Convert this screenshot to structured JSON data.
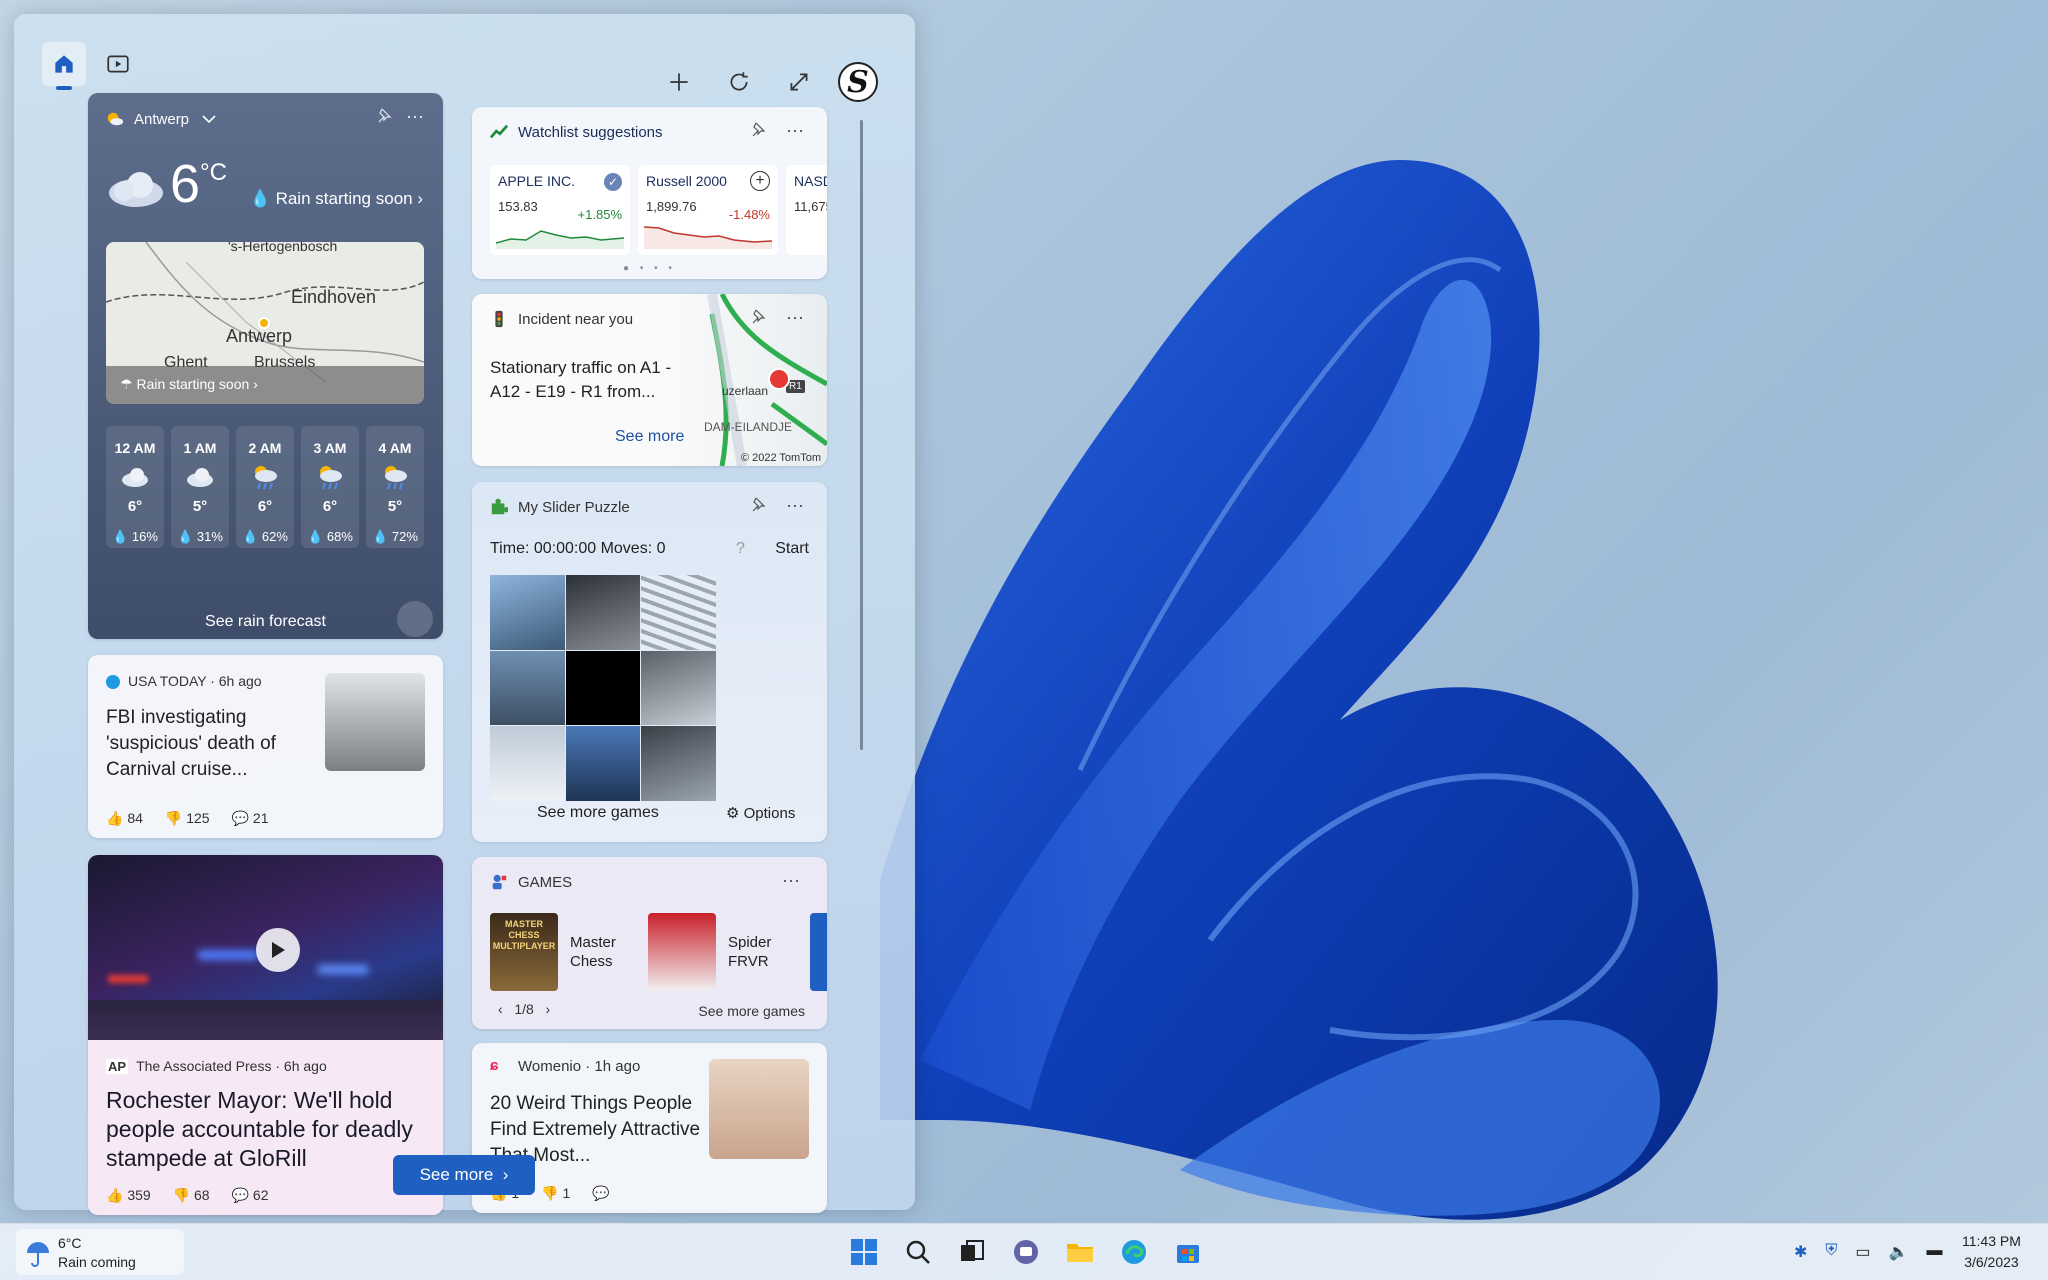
{
  "panel": {
    "avatar_letter": "S",
    "icons": [
      "home-icon",
      "video-icon",
      "plus-icon",
      "refresh-icon",
      "expand-icon"
    ]
  },
  "weather": {
    "location": "Antwerp",
    "temp": "6",
    "unit": "°C",
    "rain_label": "Rain starting soon",
    "map_labels": [
      "'s-Hertogenbosch",
      "Eindhoven",
      "Antwerp",
      "Ghent",
      "Brussels"
    ],
    "map_bar": "Rain starting soon",
    "hours": [
      {
        "t": "12 AM",
        "d": "6°",
        "p": "16%",
        "icon": "cloud"
      },
      {
        "t": "1 AM",
        "d": "5°",
        "p": "31%",
        "icon": "cloud"
      },
      {
        "t": "2 AM",
        "d": "6°",
        "p": "62%",
        "icon": "rain-night"
      },
      {
        "t": "3 AM",
        "d": "6°",
        "p": "68%",
        "icon": "rain-night"
      },
      {
        "t": "4 AM",
        "d": "5°",
        "p": "72%",
        "icon": "rain-night"
      }
    ],
    "footer": "See rain forecast"
  },
  "watchlist": {
    "title": "Watchlist suggestions",
    "stocks": [
      {
        "name": "APPLE INC.",
        "value": "153.83",
        "change": "+1.85%",
        "color": "#1f8a3a"
      },
      {
        "name": "Russell 2000",
        "value": "1,899.76",
        "change": "-1.48%",
        "color": "#c0392b"
      },
      {
        "name": "NASD",
        "value": "11,675",
        "change": "",
        "color": "#c0392b"
      }
    ]
  },
  "incident": {
    "title": "Incident near you",
    "body": "Stationary traffic on A1 - A12 - E19 - R1 from...",
    "more": "See more",
    "credit": "© 2022 TomTom",
    "map_labels": [
      "uzerlaan",
      "DAM-EILANDJE",
      "R1"
    ]
  },
  "puzzle": {
    "title": "My Slider Puzzle",
    "status": "Time: 00:00:00 Moves: 0",
    "help": "?",
    "start": "Start",
    "more": "See more games",
    "options": "Options"
  },
  "games": {
    "title": "GAMES",
    "items": [
      {
        "name": "Master Chess",
        "logo_text": "MASTER CHESS MULTIPLAYER"
      },
      {
        "name": "Spider FRVR"
      }
    ],
    "pager": "1/8",
    "more": "See more games"
  },
  "womenio": {
    "source": "Womenio · 1h ago",
    "title": "20 Weird Things People Find Extremely Attractive That Most...",
    "likes": "1",
    "dislikes": "1"
  },
  "news1": {
    "source": "USA TODAY · 6h ago",
    "title": "FBI investigating 'suspicious' death of Carnival cruise...",
    "likes": "84",
    "dislikes": "125",
    "comments": "21"
  },
  "news2": {
    "badge": "AP",
    "source": "The Associated Press · 6h ago",
    "title": "Rochester Mayor: We'll hold people accountable for deadly stampede at GloRill",
    "likes": "359",
    "dislikes": "68",
    "comments": "62"
  },
  "see_more": "See more",
  "taskbar": {
    "weather_temp": "6°C",
    "weather_text": "Rain coming",
    "time": "11:43 PM",
    "date": "3/6/2023"
  }
}
